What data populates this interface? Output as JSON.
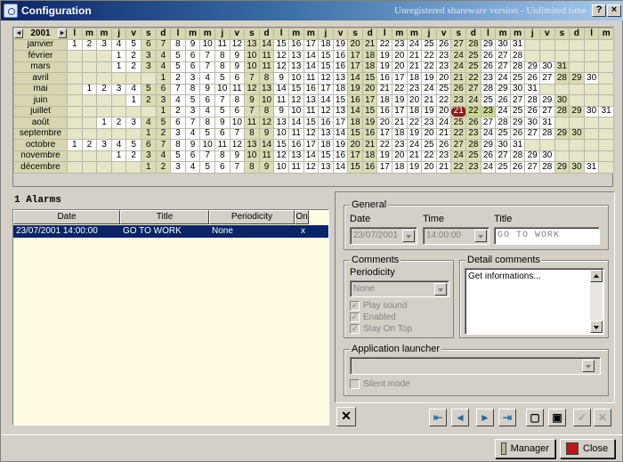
{
  "window": {
    "title": "Configuration",
    "unregistered": "Unregistered shareware version - Unlimited time",
    "help_glyph": "?",
    "close_glyph": "×"
  },
  "calendar": {
    "year": "2001",
    "prev_glyph": "◄",
    "next_glyph": "►",
    "header": [
      "l",
      "m",
      "m",
      "j",
      "v",
      "s",
      "d",
      "l",
      "m",
      "m",
      "j",
      "v",
      "s",
      "d",
      "l",
      "m",
      "m",
      "j",
      "v",
      "s",
      "d",
      "l",
      "m",
      "m",
      "j",
      "v",
      "s",
      "d",
      "l",
      "m",
      "m",
      "j",
      "v",
      "s",
      "d",
      "l",
      "m"
    ],
    "months": [
      {
        "name": "janvier",
        "offset": 0,
        "days": 31
      },
      {
        "name": "février",
        "offset": 3,
        "days": 28
      },
      {
        "name": "mars",
        "offset": 3,
        "days": 31
      },
      {
        "name": "avril",
        "offset": 6,
        "days": 30
      },
      {
        "name": "mai",
        "offset": 1,
        "days": 31
      },
      {
        "name": "juin",
        "offset": 4,
        "days": 30
      },
      {
        "name": "juillet",
        "offset": 6,
        "days": 31
      },
      {
        "name": "août",
        "offset": 2,
        "days": 31
      },
      {
        "name": "septembre",
        "offset": 5,
        "days": 30
      },
      {
        "name": "octobre",
        "offset": 0,
        "days": 31
      },
      {
        "name": "novembre",
        "offset": 3,
        "days": 30
      },
      {
        "name": "décembre",
        "offset": 5,
        "days": 31
      }
    ],
    "today": {
      "month": 6,
      "day": 21
    },
    "selected": {
      "month": 6,
      "days": [
        22,
        23
      ]
    }
  },
  "alarms": {
    "count_label": "1 Alarms",
    "columns": {
      "date": "Date",
      "title": "Title",
      "periodicity": "Periodicity",
      "on": "On"
    },
    "rows": [
      {
        "date": "23/07/2001 14:00:00",
        "title": "GO TO WORK",
        "periodicity": "None",
        "on": "x"
      }
    ]
  },
  "general": {
    "group_label": "General",
    "date_label": "Date",
    "time_label": "Time",
    "title_label": "Title",
    "date_value": "23/07/2001",
    "time_value": "14:00:00",
    "title_value": "GO TO WORK"
  },
  "comments": {
    "group_label": "Comments",
    "periodicity_label": "Periodicity",
    "periodicity_value": "None",
    "play_sound": "Play sound",
    "enabled": "Enabled",
    "stay_on_top": "Stay On Top",
    "check_glyph": "✓"
  },
  "detail": {
    "group_label": "Detail comments",
    "text": "Get informations..."
  },
  "launcher": {
    "group_label": "Application launcher",
    "path": "",
    "silent_mode": "Silent mode"
  },
  "toolbar": {
    "delete": "✕",
    "first": "⇤",
    "prev": "◄",
    "next": "►",
    "last": "⇥",
    "new": "▢",
    "save": "▣",
    "undo": "✓",
    "cancel": "✕"
  },
  "buttons": {
    "manager": "Manager",
    "close": "Close"
  }
}
